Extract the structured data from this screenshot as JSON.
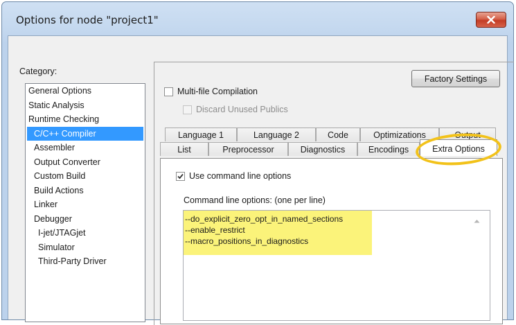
{
  "window": {
    "title": "Options for node \"project1\"",
    "close_icon": "close-icon",
    "accent_close": "#c9432b"
  },
  "category": {
    "label": "Category:",
    "items": [
      {
        "label": "General Options",
        "level": 1
      },
      {
        "label": "Static Analysis",
        "level": 1
      },
      {
        "label": "Runtime Checking",
        "level": 1
      },
      {
        "label": "C/C++ Compiler",
        "level": 2,
        "selected": true
      },
      {
        "label": "Assembler",
        "level": 2
      },
      {
        "label": "Output Converter",
        "level": 2
      },
      {
        "label": "Custom Build",
        "level": 2
      },
      {
        "label": "Build Actions",
        "level": 2
      },
      {
        "label": "Linker",
        "level": 2
      },
      {
        "label": "Debugger",
        "level": 2
      },
      {
        "label": "I-jet/JTAGjet",
        "level": 3
      },
      {
        "label": "Simulator",
        "level": 3
      },
      {
        "label": "Third-Party Driver",
        "level": 3
      }
    ]
  },
  "factory_settings_label": "Factory Settings",
  "multifile": {
    "label": "Multi-file Compilation",
    "checked": false
  },
  "discard": {
    "label": "Discard Unused Publics",
    "checked": false,
    "disabled": true
  },
  "tabs_row1": [
    "Language 1",
    "Language 2",
    "Code",
    "Optimizations",
    "Output"
  ],
  "tabs_row2": [
    "List",
    "Preprocessor",
    "Diagnostics",
    "Encodings",
    "Extra Options"
  ],
  "active_tab": "Extra Options",
  "use_cmdline": {
    "label": "Use command line options",
    "checked": true
  },
  "cmdline_label": "Command line options:  (one per line)",
  "cmdline_lines": [
    "--do_explicit_zero_opt_in_named_sections",
    "--enable_restrict",
    "--macro_positions_in_diagnostics"
  ],
  "highlight_color": "#fbf37a",
  "callout_color": "#f2c21a"
}
